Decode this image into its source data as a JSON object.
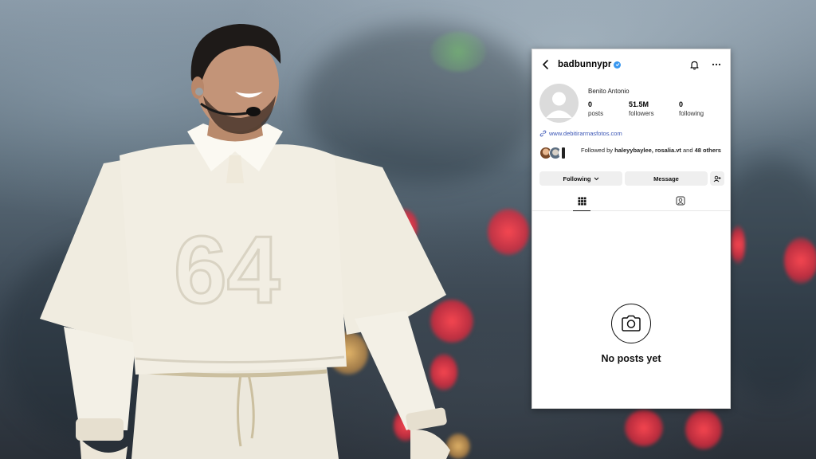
{
  "profile": {
    "username": "badbunnypr",
    "display_name": "Benito Antonio",
    "stats": [
      {
        "value": "0",
        "label": "posts"
      },
      {
        "value": "51.5M",
        "label": "followers"
      },
      {
        "value": "0",
        "label": "following"
      }
    ],
    "link": "www.debitirarmasfotos.com",
    "followed_by": {
      "prefix": "Followed by ",
      "names": "haleyybaylee, rosalia.vt",
      "and": " and ",
      "others": "48 others"
    },
    "buttons": {
      "following": "Following",
      "message": "Message"
    },
    "empty_state": "No posts yet"
  },
  "photo": {
    "jersey_number": "64"
  },
  "colors": {
    "verified": "#3897f0",
    "link": "#3a55b5",
    "button_bg": "#efefef"
  },
  "icons": [
    "back-arrow-icon",
    "verified-badge-icon",
    "bell-icon",
    "more-icon",
    "link-icon",
    "chevron-down-icon",
    "add-user-icon",
    "grid-icon",
    "tagged-icon",
    "camera-icon"
  ]
}
